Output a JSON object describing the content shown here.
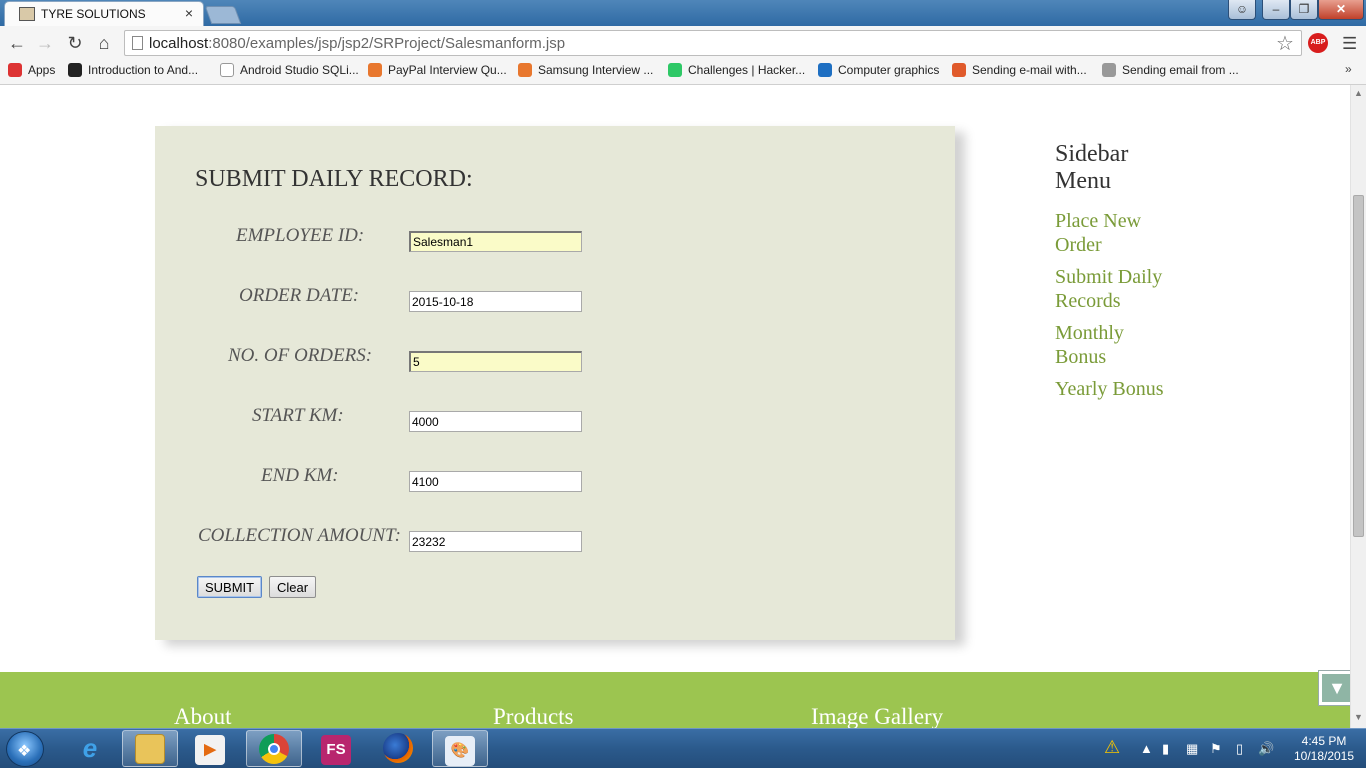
{
  "browser": {
    "tab_title": "TYRE SOLUTIONS",
    "url_host": "localhost",
    "url_path": ":8080/examples/jsp/jsp2/SRProject/Salesmanform.jsp",
    "abp_label": "ABP"
  },
  "bookmarks": [
    {
      "label": "Apps",
      "icon": "apps-grid-icon",
      "color": "#d33"
    },
    {
      "label": "Introduction to And...",
      "icon": "github-icon",
      "color": "#222"
    },
    {
      "label": "Android Studio SQLi...",
      "icon": "page-icon",
      "color": "#fff"
    },
    {
      "label": "PayPal Interview Qu...",
      "icon": "stack-icon",
      "color": "#e8772e"
    },
    {
      "label": "Samsung Interview ...",
      "icon": "stack-icon",
      "color": "#e8772e"
    },
    {
      "label": "Challenges | Hacker...",
      "icon": "hackerrank-icon",
      "color": "#2ec866"
    },
    {
      "label": "Computer graphics",
      "icon": "bookmark-icon",
      "color": "#1e6fc2"
    },
    {
      "label": "Sending e-mail with...",
      "icon": "j-icon",
      "color": "#e05a2b"
    },
    {
      "label": "Sending email from ...",
      "icon": "share-icon",
      "color": "#999"
    }
  ],
  "form": {
    "title": "SUBMIT DAILY RECORD:",
    "fields": [
      {
        "label": "EMPLOYEE ID:",
        "value": "Salesman1"
      },
      {
        "label": "ORDER DATE:",
        "value": "2015-10-18"
      },
      {
        "label": "NO. OF ORDERS:",
        "value": "5"
      },
      {
        "label": "START KM:",
        "value": "4000"
      },
      {
        "label": "END KM:",
        "value": "4100"
      },
      {
        "label": "COLLECTION AMOUNT:",
        "value": "23232"
      }
    ],
    "submit_label": "SUBMIT",
    "clear_label": "Clear"
  },
  "sidebar": {
    "title": "Sidebar Menu",
    "links": [
      "Place New Order",
      "Submit Daily Records",
      "Monthly Bonus",
      "Yearly Bonus"
    ]
  },
  "footer": {
    "headings": [
      "About",
      "Products",
      "Image Gallery"
    ]
  },
  "taskbar": {
    "time": "4:45 PM",
    "date": "10/18/2015",
    "apps": [
      "internet-explorer",
      "file-explorer",
      "media-player",
      "chrome",
      "fs",
      "firefox",
      "paint"
    ],
    "fs_label": "FS"
  },
  "colors": {
    "panel": "#e6e8d8",
    "sidebar_link": "#7a9b38",
    "footer": "#9cc550",
    "filled_input": "#fafbc8"
  }
}
